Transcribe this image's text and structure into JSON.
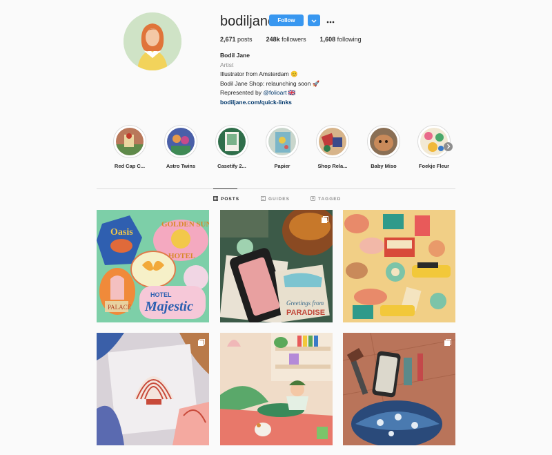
{
  "profile": {
    "username": "bodiljane",
    "follow_label": "Follow",
    "stats": {
      "posts_count": "2,671",
      "posts_label": "posts",
      "followers_count": "248k",
      "followers_label": "followers",
      "following_count": "1,608",
      "following_label": "following"
    },
    "bio": {
      "name": "Bodil Jane",
      "category": "Artist",
      "line1": "Illustrator from Amsterdam 😊",
      "line2": "Bodil Jane Shop: relaunching soon 🚀",
      "line3_prefix": "Represented by ",
      "line3_mention": "@folioart",
      "line3_suffix": " 🇬🇧",
      "link": "bodiljane.com/quick-links"
    }
  },
  "highlights": [
    {
      "label": "Red Cap C..."
    },
    {
      "label": "Astro Twins"
    },
    {
      "label": "Casetify 2..."
    },
    {
      "label": "Papier"
    },
    {
      "label": "Shop Rela..."
    },
    {
      "label": "Baby Miso"
    },
    {
      "label": "Foekje Fleur"
    }
  ],
  "tabs": [
    {
      "label": "POSTS"
    },
    {
      "label": "GUIDES"
    },
    {
      "label": "TAGGED"
    }
  ],
  "icons": {
    "chevron": "chevron-down-icon",
    "more": "more-dots-icon",
    "next": "chevron-right-icon",
    "grid": "grid-icon",
    "guides": "guides-icon",
    "tagged": "tagged-icon",
    "multi": "multi-post-icon"
  },
  "colors": {
    "accent": "#3897f0",
    "link": "#00376b"
  }
}
